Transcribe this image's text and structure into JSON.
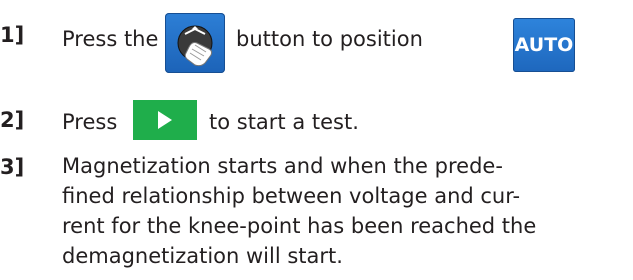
{
  "steps": [
    {
      "number": "1]",
      "text_before": "Press the",
      "icon": "rotary-knob-hand-icon",
      "text_after": "button to position",
      "badge": "AUTO"
    },
    {
      "number": "2]",
      "text_before": "Press",
      "icon": "play-icon",
      "text_after": "to start a test."
    },
    {
      "number": "3]",
      "lines": [
        "Magnetization starts and when the prede-",
        "fined relationship between voltage and cur-",
        "rent for the knee-point has been reached the",
        "demagnetization will start."
      ]
    }
  ],
  "colors": {
    "button_blue": "#1f6fc9",
    "play_green": "#1fae4b",
    "text": "#231f20"
  }
}
